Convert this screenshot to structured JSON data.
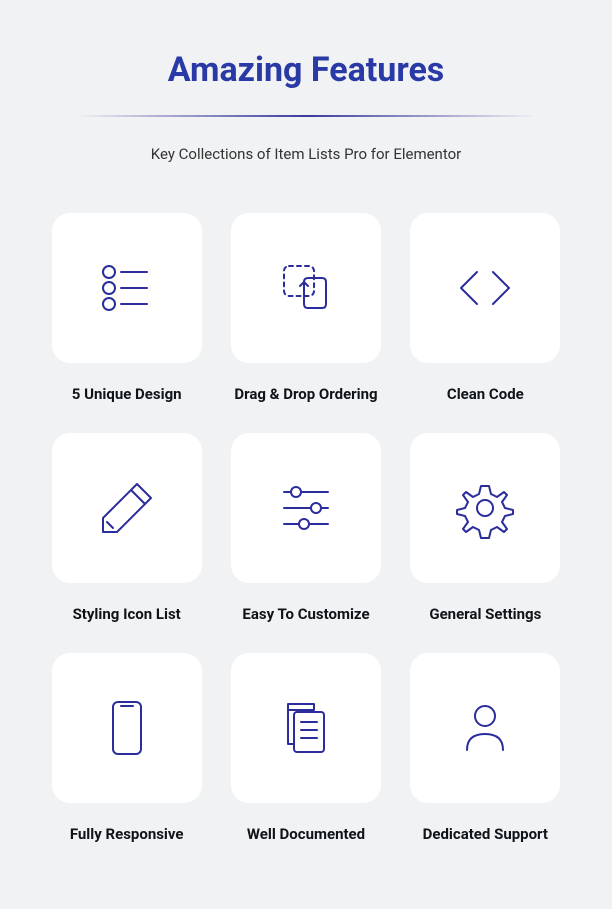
{
  "header": {
    "title": "Amazing Features",
    "subtitle": "Key Collections of Item Lists Pro for Elementor"
  },
  "features": [
    {
      "label": "5 Unique Design"
    },
    {
      "label": "Drag & Drop Ordering"
    },
    {
      "label": "Clean Code"
    },
    {
      "label": "Styling Icon List"
    },
    {
      "label": "Easy To Customize"
    },
    {
      "label": "General Settings"
    },
    {
      "label": "Fully Responsive"
    },
    {
      "label": "Well Documented"
    },
    {
      "label": "Dedicated Support"
    }
  ]
}
